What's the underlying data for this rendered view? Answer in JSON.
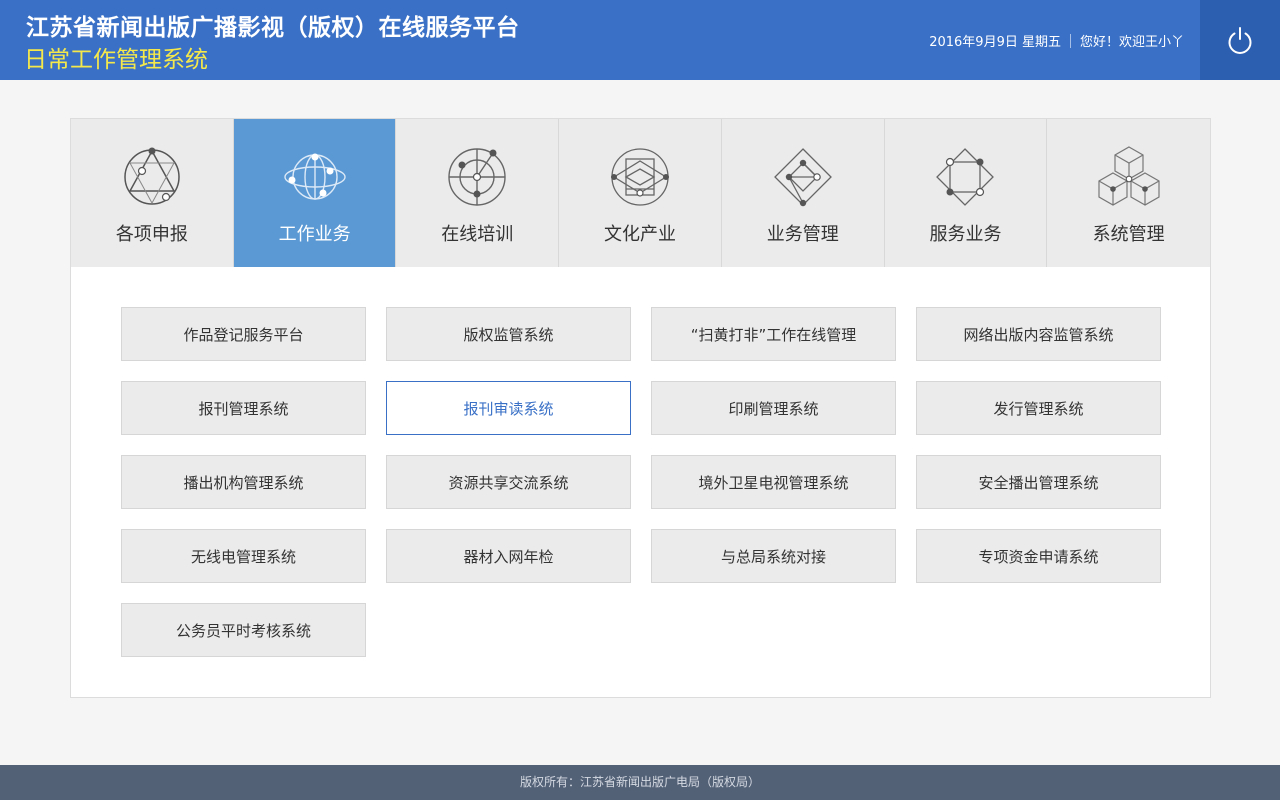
{
  "header": {
    "title": "江苏省新闻出版广播影视（版权）在线服务平台",
    "subtitle": "日常工作管理系统",
    "date": "2016年9月9日 星期五",
    "welcome": "您好！欢迎王小丫",
    "power_icon": "power-icon"
  },
  "tabs": [
    {
      "label": "各项申报",
      "icon": "star-circle-icon",
      "active": false
    },
    {
      "label": "工作业务",
      "icon": "globe-orbit-icon",
      "active": true
    },
    {
      "label": "在线培训",
      "icon": "target-icon",
      "active": false
    },
    {
      "label": "文化产业",
      "icon": "layered-diamond-icon",
      "active": false
    },
    {
      "label": "业务管理",
      "icon": "diamond-network-icon",
      "active": false
    },
    {
      "label": "服务业务",
      "icon": "square-diamond-icon",
      "active": false
    },
    {
      "label": "系统管理",
      "icon": "cubes-icon",
      "active": false
    }
  ],
  "systems": [
    {
      "label": "作品登记服务平台"
    },
    {
      "label": "版权监管系统"
    },
    {
      "label": "“扫黄打非”工作在线管理"
    },
    {
      "label": "网络出版内容监管系统"
    },
    {
      "label": "报刊管理系统"
    },
    {
      "label": "报刊审读系统",
      "selected": true
    },
    {
      "label": "印刷管理系统"
    },
    {
      "label": "发行管理系统"
    },
    {
      "label": "播出机构管理系统"
    },
    {
      "label": "资源共享交流系统"
    },
    {
      "label": "境外卫星电视管理系统"
    },
    {
      "label": "安全播出管理系统"
    },
    {
      "label": "无线电管理系统"
    },
    {
      "label": "器材入网年检"
    },
    {
      "label": "与总局系统对接"
    },
    {
      "label": "专项资金申请系统"
    },
    {
      "label": "公务员平时考核系统"
    }
  ],
  "footer": {
    "copyright": "版权所有：江苏省新闻出版广电局（版权局）"
  },
  "colors": {
    "header_bg": "#3a71c7",
    "subtitle": "#f5e84a",
    "active_tab": "#5a99d4",
    "footer_bg": "#536177"
  }
}
